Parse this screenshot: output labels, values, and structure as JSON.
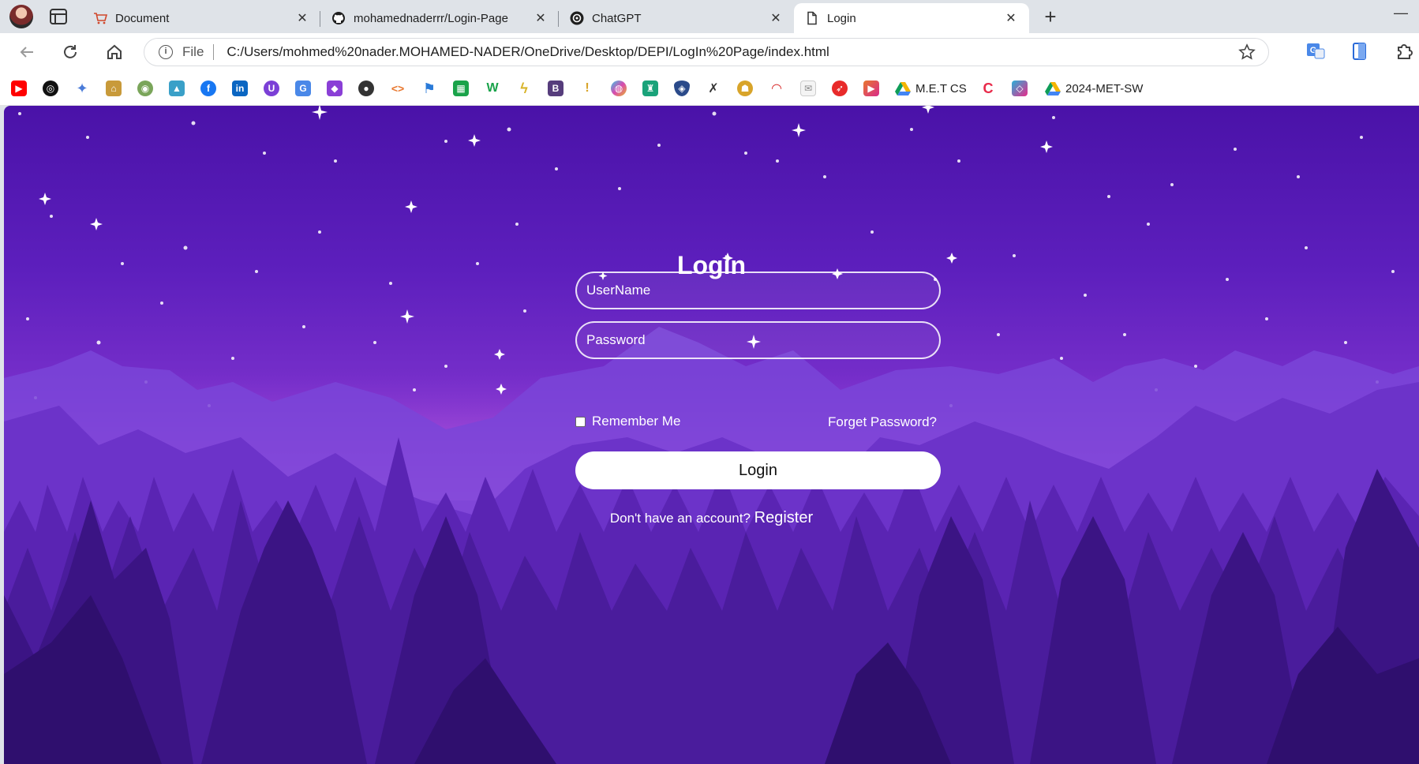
{
  "browser": {
    "tabs": [
      {
        "title": "Document",
        "icon": "cart-icon",
        "active": false
      },
      {
        "title": "mohamednaderrr/Login-Page",
        "icon": "github-icon",
        "active": false
      },
      {
        "title": "ChatGPT",
        "icon": "chatgpt-icon",
        "active": false
      },
      {
        "title": "Login",
        "icon": "page-icon",
        "active": true
      }
    ],
    "close_glyph": "✕",
    "new_tab_glyph": "+",
    "minimize_glyph": "—",
    "address": {
      "scheme_label": "File",
      "url": "C:/Users/mohmed%20nader.MOHAMED-NADER/OneDrive/Desktop/DEPI/LogIn%20Page/index.html"
    },
    "bookmarks": [
      {
        "icon": "youtube-icon",
        "label": "",
        "color": "#ff0000"
      },
      {
        "icon": "chatgpt-icon",
        "label": "",
        "color": "#111111"
      },
      {
        "icon": "gemini-icon",
        "label": "",
        "color": "#4a7bd8"
      },
      {
        "icon": "building-icon",
        "label": "",
        "color": "#c89a3a"
      },
      {
        "icon": "seal-icon",
        "label": "",
        "color": "#7aa55a"
      },
      {
        "icon": "landscape-icon",
        "label": "",
        "color": "#3aa0c8"
      },
      {
        "icon": "facebook-icon",
        "label": "",
        "color": "#1877f2"
      },
      {
        "icon": "linkedin-icon",
        "label": "",
        "color": "#0a66c2"
      },
      {
        "icon": "udemy-icon",
        "label": "",
        "color": "#7b3fd6"
      },
      {
        "icon": "translate-icon",
        "label": "",
        "color": "#4a88e8"
      },
      {
        "icon": "cube-icon",
        "label": "",
        "color": "#8a3fd6"
      },
      {
        "icon": "github-icon",
        "label": "",
        "color": "#333333"
      },
      {
        "icon": "code-icon",
        "label": "",
        "color": "#e8772e"
      },
      {
        "icon": "flag-icon",
        "label": "",
        "color": "#2a7ad8"
      },
      {
        "icon": "grid-icon",
        "label": "",
        "color": "#1aa34a"
      },
      {
        "icon": "w-icon",
        "label": "",
        "color": "#1aa34a"
      },
      {
        "icon": "lightning-icon",
        "label": "",
        "color": "#d8b42a"
      },
      {
        "icon": "b-icon",
        "label": "",
        "color": "#563d7c"
      },
      {
        "icon": "candle-icon",
        "label": "",
        "color": "#d8a42a"
      },
      {
        "icon": "copilot-icon",
        "label": "",
        "color": "#d84ab0"
      },
      {
        "icon": "castle-icon",
        "label": "",
        "color": "#1aa37a"
      },
      {
        "icon": "shield-icon",
        "label": "",
        "color": "#2a4a8a"
      },
      {
        "icon": "feather-icon",
        "label": "",
        "color": "#333333"
      },
      {
        "icon": "cup-icon",
        "label": "",
        "color": "#d8a42a"
      },
      {
        "icon": "gauge-icon",
        "label": "",
        "color": "#d82a2a"
      },
      {
        "icon": "mail-icon",
        "label": "",
        "color": "#cccccc"
      },
      {
        "icon": "compass-icon",
        "label": "",
        "color": "#e82a2a"
      },
      {
        "icon": "play-icon",
        "label": "",
        "color": "#e8772e"
      },
      {
        "icon": "drive-icon",
        "label": "M.E.T CS",
        "color": "#1aa34a"
      },
      {
        "icon": "c-icon",
        "label": "",
        "color": "#e82a4a"
      },
      {
        "icon": "box-icon",
        "label": "",
        "color": "#2ab0d8"
      },
      {
        "icon": "drive-icon",
        "label": "2024-MET-SW",
        "color": "#1aa34a"
      }
    ]
  },
  "page": {
    "title": "Login",
    "username_placeholder": "UserName",
    "password_placeholder": "Password",
    "remember_label": "Remember Me",
    "forgot_label": "Forget Password?",
    "login_button": "Login",
    "no_account_text": "Don't have an account?",
    "register_link": "Register"
  }
}
